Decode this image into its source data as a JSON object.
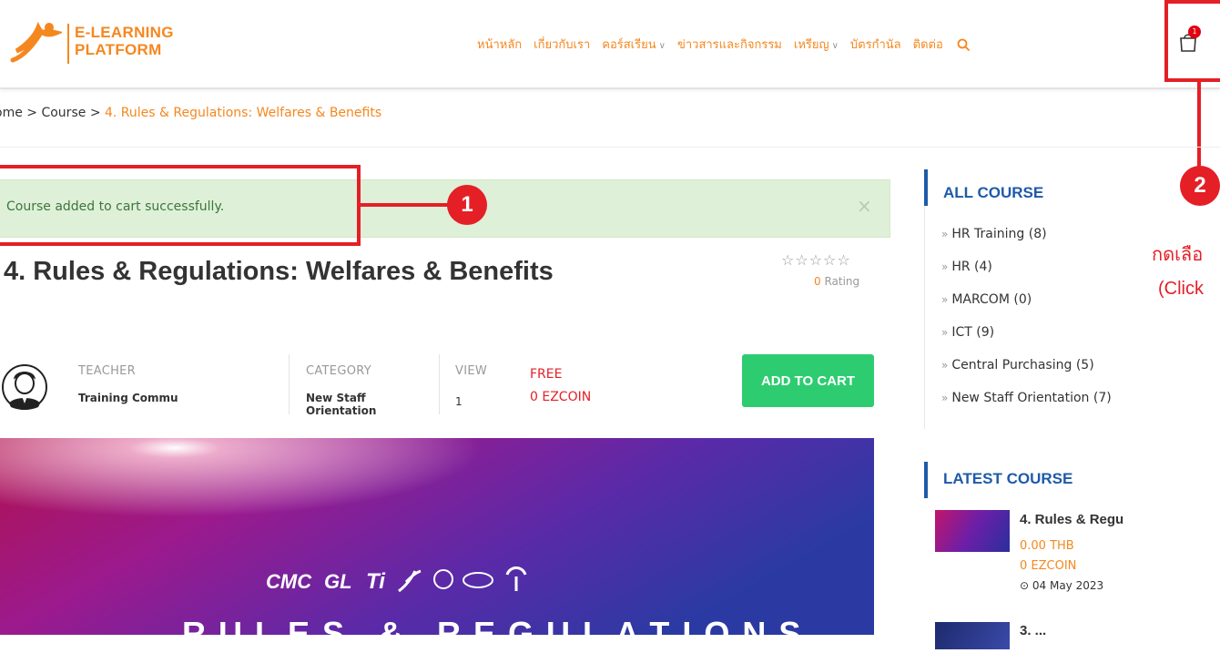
{
  "brand": {
    "line1": "E-LEARNING",
    "line2": "PLATFORM",
    "color": "#f5871f"
  },
  "nav": {
    "items": [
      {
        "label": "หน้าหลัก",
        "dropdown": false
      },
      {
        "label": "เกี่ยวกับเรา",
        "dropdown": false
      },
      {
        "label": "คอร์สเรียน",
        "dropdown": true
      },
      {
        "label": "ข่าวสารและกิจกรรม",
        "dropdown": false
      },
      {
        "label": "เหรียญ",
        "dropdown": true
      },
      {
        "label": "บัตรกำนัล",
        "dropdown": false
      },
      {
        "label": "ติดต่อ",
        "dropdown": false
      }
    ],
    "cart_count": "1"
  },
  "breadcrumb": {
    "home": "ome",
    "sep": ">",
    "course": "Course",
    "current": "4. Rules & Regulations: Welfares & Benefits"
  },
  "alert": {
    "message": "Course added to cart successfully.",
    "close": "×"
  },
  "annotations": {
    "step1": "1",
    "step2": "2",
    "hint_th": "กดเลือ",
    "hint_en": "(Click",
    "color": "#e41f26"
  },
  "course": {
    "title": "4. Rules & Regulations: Welfares & Benefits",
    "stars": "☆☆☆☆☆",
    "rating_count": "0",
    "rating_label": "Rating",
    "teacher_label": "TEACHER",
    "teacher_value": "Training Commu",
    "category_label": "CATEGORY",
    "category_value_line1": "New Staff",
    "category_value_line2": "Orientation",
    "view_label": "VIEW",
    "view_value": "1",
    "price_free": "FREE",
    "price_coin": "0 EZCOIN",
    "add_to_cart": "ADD TO CART"
  },
  "banner": {
    "text": "RULES & REGULATIONS"
  },
  "sidebar": {
    "all_course_title": "ALL COURSE",
    "categories": [
      "HR Training (8)",
      "HR (4)",
      "MARCOM (0)",
      "ICT (9)",
      "Central Purchasing (5)",
      "New Staff Orientation (7)"
    ],
    "latest_title": "LATEST COURSE",
    "latest": {
      "title": "4. Rules & Regu",
      "price": "0.00 THB",
      "coin": "0 EZCOIN",
      "date": "04 May 2023",
      "title2": "3. ..."
    }
  }
}
